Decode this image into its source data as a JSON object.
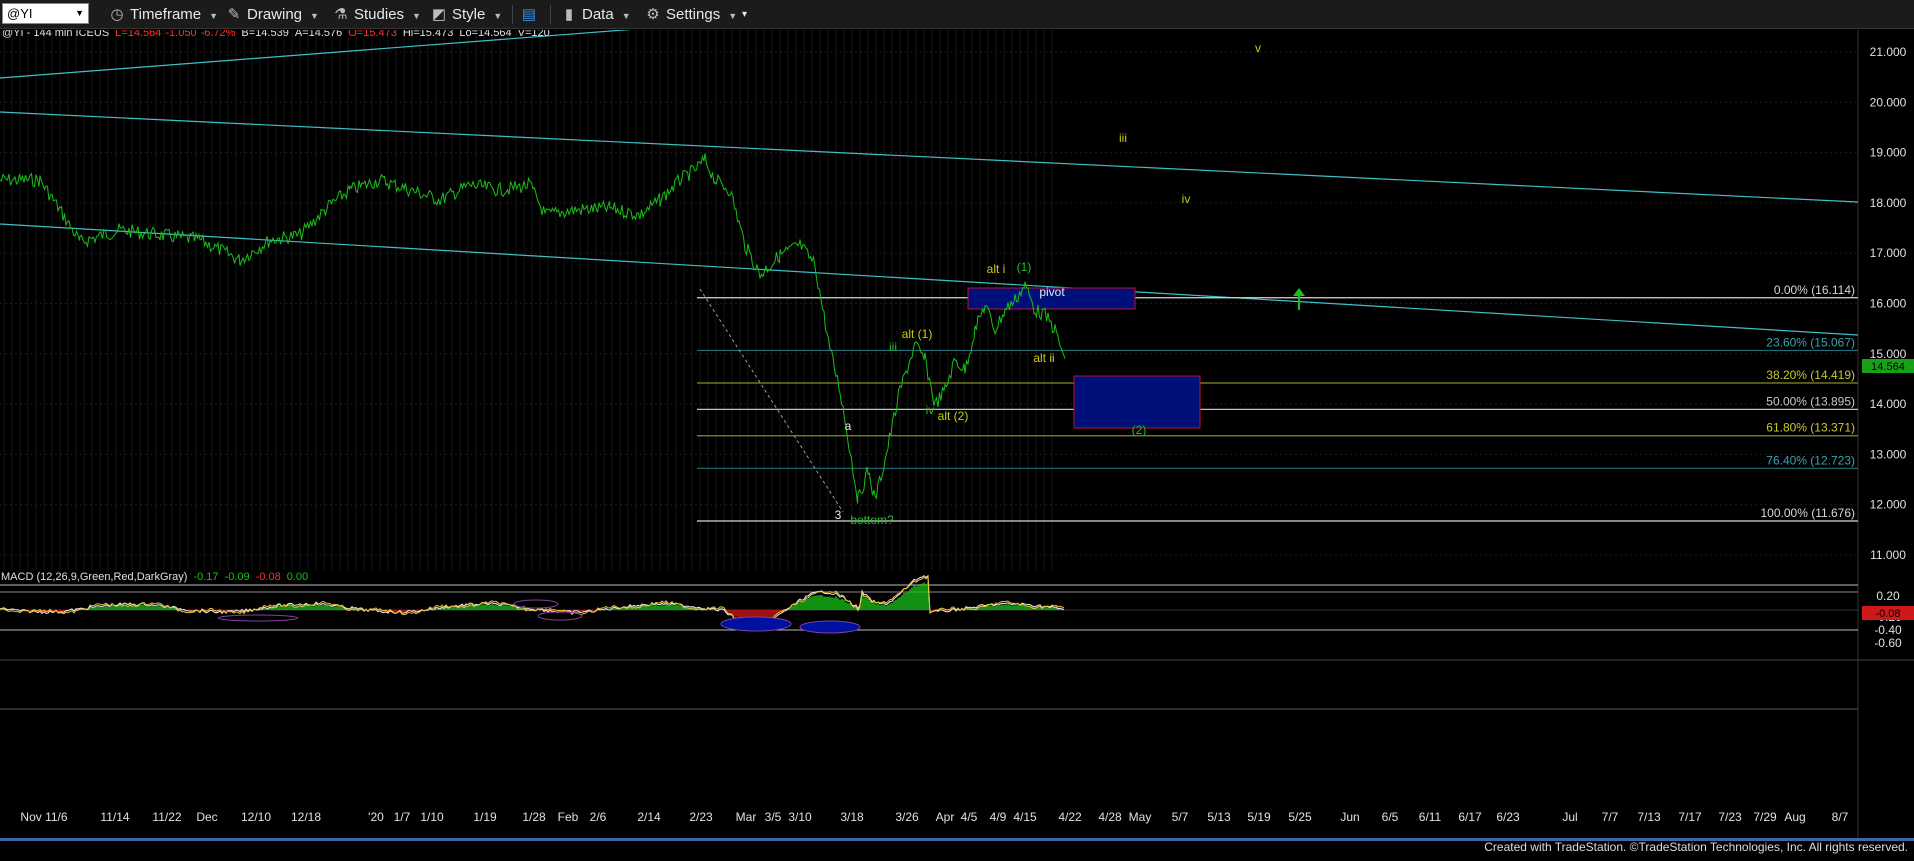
{
  "toolbar": {
    "symbol": "@YI",
    "timeframe": "Timeframe",
    "drawing": "Drawing",
    "studies": "Studies",
    "style": "Style",
    "data": "Data",
    "settings": "Settings"
  },
  "header": {
    "symbol": "@YI",
    "interval": "144 min",
    "exchange": "ICEUS",
    "last": "L=14.564",
    "change": "-1.050",
    "pct": "-6.72%",
    "bid": "B=14.539",
    "ask": "A=14.576",
    "open": "O=15.473",
    "high": "Hi=15.473",
    "low": "Lo=14.564",
    "volume": "V=120"
  },
  "price_axis": [
    "21.000",
    "20.000",
    "19.000",
    "18.000",
    "17.000",
    "16.000",
    "15.000",
    "14.000",
    "13.000",
    "12.000",
    "11.000"
  ],
  "last_price": "14.564",
  "fib_levels": [
    {
      "label": "0.00% (16.114)",
      "value": 16.114,
      "color": "#d8d8d8"
    },
    {
      "label": "23.60% (15.067)",
      "value": 15.067,
      "color": "#1f6f78"
    },
    {
      "label": "38.20% (14.419)",
      "value": 14.419,
      "color": "#8a8a2a"
    },
    {
      "label": "50.00% (13.895)",
      "value": 13.895,
      "color": "#c0c0c0"
    },
    {
      "label": "61.80% (13.371)",
      "value": 13.371,
      "color": "#8a8a2a"
    },
    {
      "label": "76.40% (12.723)",
      "value": 12.723,
      "color": "#1f6f78"
    },
    {
      "label": "100.00% (11.676)",
      "value": 11.676,
      "color": "#d8d8d8"
    }
  ],
  "annotations": [
    {
      "text": "v",
      "color": "#c8c818"
    },
    {
      "text": "iii",
      "color": "#c8c818"
    },
    {
      "text": "iv",
      "color": "#c8c818"
    },
    {
      "text": "alt i",
      "color": "#c8c818"
    },
    {
      "text": "(1)",
      "color": "#2aba2a"
    },
    {
      "text": "pivot",
      "color": "#e8e8e8"
    },
    {
      "text": "alt ii",
      "color": "#c8c818"
    },
    {
      "text": "alt (1)",
      "color": "#c8c818"
    },
    {
      "text": "iii",
      "color": "#2aba2a"
    },
    {
      "text": "iv",
      "color": "#2aba2a"
    },
    {
      "text": "alt (2)",
      "color": "#c8c818"
    },
    {
      "text": "(2)",
      "color": "#2aba2a"
    },
    {
      "text": "a",
      "color": "#e8e8e8"
    },
    {
      "text": "3",
      "color": "#e8e8e8"
    },
    {
      "text": "bottom?",
      "color": "#2aba2a"
    }
  ],
  "macd": {
    "label": "MACD (12,26,9,Green,Red,DarkGray)",
    "v1": "-0.17",
    "v2": "-0.09",
    "v3": "-0.08",
    "v4": "0.00",
    "axis": [
      "0.20",
      "-0.20",
      "-0.40",
      "-0.60"
    ],
    "current": "-0.08"
  },
  "time_axis": [
    "Nov 11/6",
    "11/14",
    "11/22",
    "Dec",
    "12/10",
    "12/18",
    "'20",
    "1/7",
    "1/10",
    "1/19",
    "1/28",
    "Feb",
    "2/6",
    "2/14",
    "2/23",
    "Mar",
    "3/5",
    "3/10",
    "3/18",
    "3/26",
    "Apr",
    "4/5",
    "4/9",
    "4/15",
    "4/22",
    "4/28",
    "May",
    "5/7",
    "5/13",
    "5/19",
    "5/25",
    "Jun",
    "6/5",
    "6/11",
    "6/17",
    "6/23",
    "Jul",
    "7/7",
    "7/13",
    "7/17",
    "7/23",
    "7/29",
    "Aug",
    "8/7"
  ],
  "footer": "Created with TradeStation. ©TradeStation Technologies, Inc. All rights reserved.",
  "colors": {
    "price": "#18c018",
    "channel": "#3ec0c8",
    "box": "#00107a",
    "up_arrow": "#18c018"
  }
}
